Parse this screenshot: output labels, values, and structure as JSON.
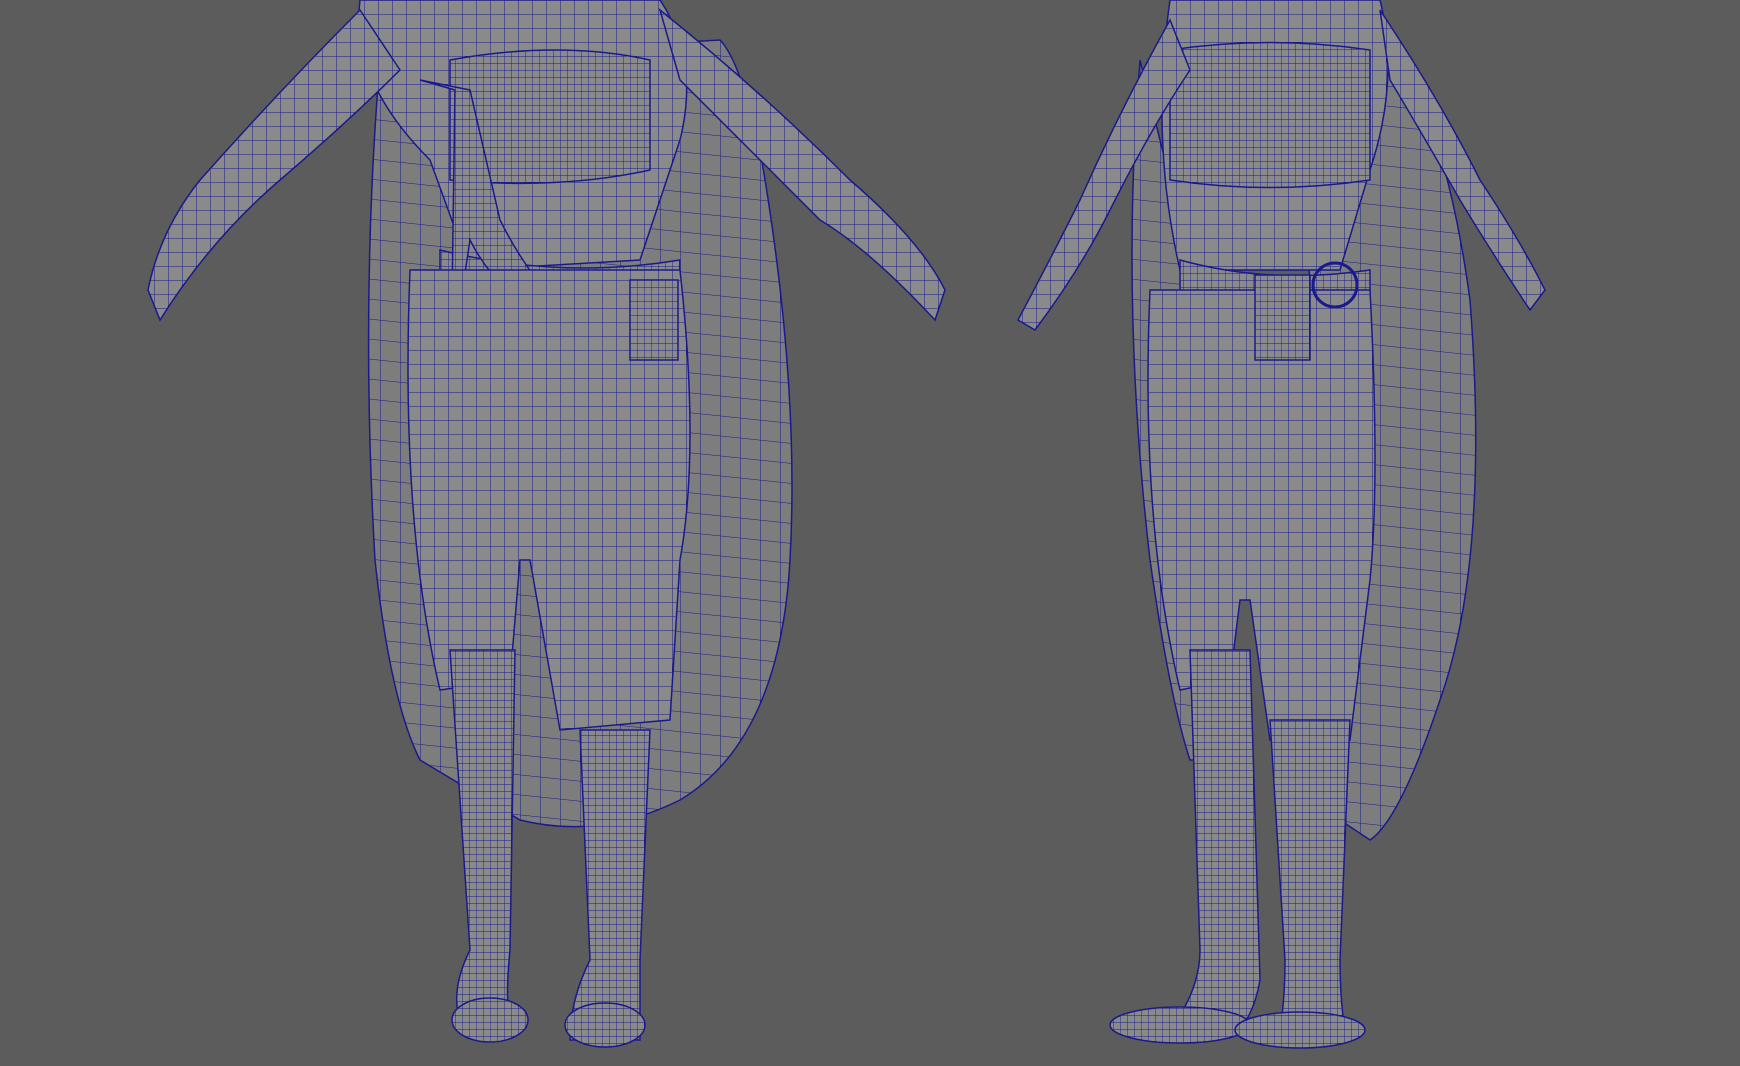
{
  "viewport": {
    "background": "#5c5c5c",
    "mesh_fill": "#8a8a8a",
    "mesh_fill_dark": "#6e6e6e",
    "wire_color": "#1a1a8c"
  },
  "views": [
    {
      "id": "front",
      "label": ""
    },
    {
      "id": "three-quarter",
      "label": ""
    }
  ]
}
